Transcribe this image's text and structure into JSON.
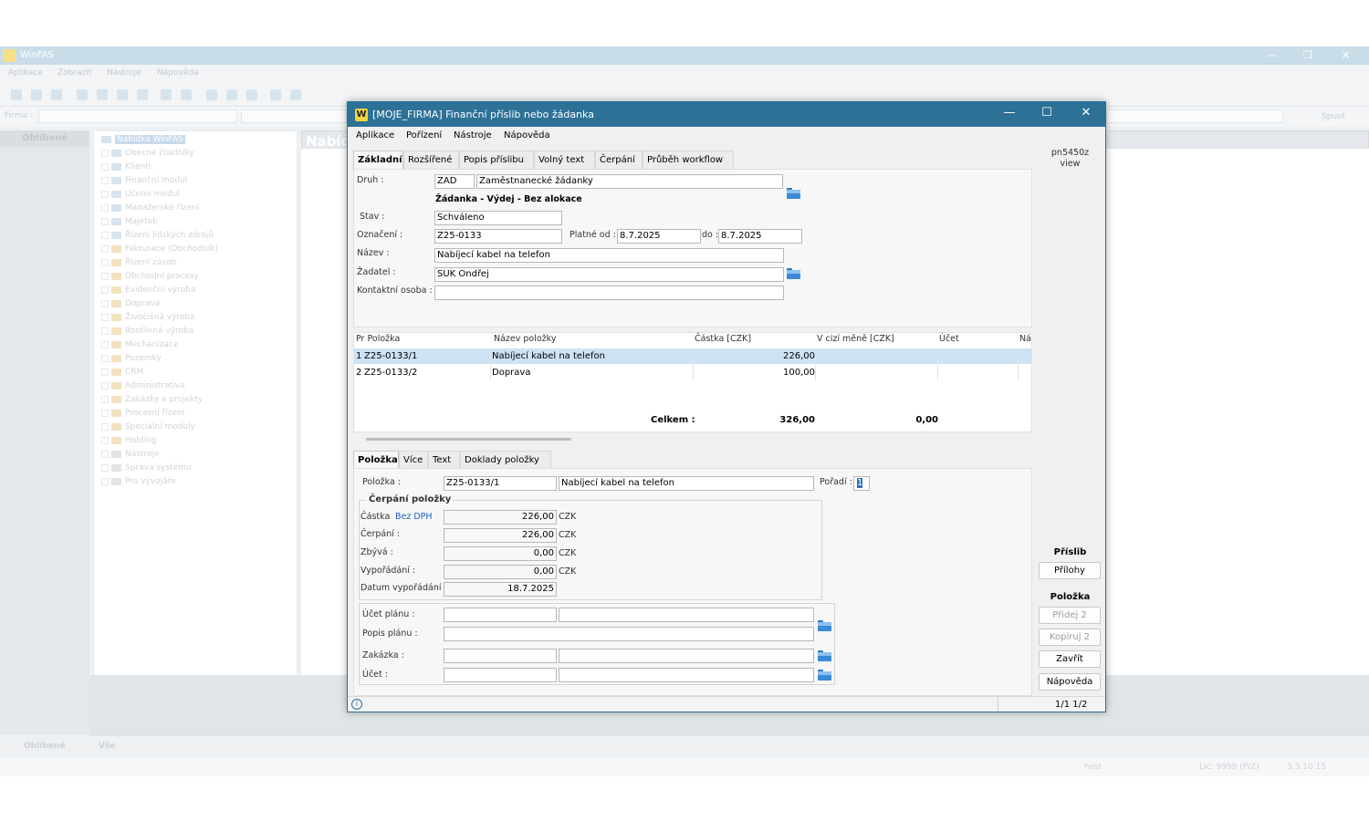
{
  "bg": {
    "title": "WinFAS",
    "menu": [
      "Aplikace",
      "Zobrazit",
      "Nástroje",
      "Nápověda"
    ],
    "firma_label": "Firma :",
    "spust": "Spusť",
    "left_header": "Oblíbené",
    "content_tab": "Nabíd",
    "tree": [
      "Nabídka WinFAS",
      "Obecné číselníky",
      "Klienti",
      "Finanční modul",
      "Účetní modul",
      "Manažerské řízení",
      "Majetek",
      "Řízení lidských zdrojů",
      "Fakturace (Obchodník)",
      "Řízení zásob",
      "Obchodní procesy",
      "Evidenční výroba",
      "Doprava",
      "Živočišná výroba",
      "Rostlinná výroba",
      "Mechanizace",
      "Pozemky",
      "CRM",
      "Administrativa",
      "Zakázky a projekty",
      "Procesní řízení",
      "Speciální moduly",
      "Holding",
      "Nástroje",
      "Správa systému",
      "Pro vývojáře"
    ],
    "status_left": "Oblíbené",
    "status_mid": "Vše",
    "status_host": "host",
    "status_lic": "Lic: 9999 (P/Z)",
    "status_ver": "3.3.10.15"
  },
  "dialog": {
    "title": "[MOJE_FIRMA] Finanční příslib nebo žádanka",
    "logo": "W",
    "menu": [
      "Aplikace",
      "Pořízení",
      "Nástroje",
      "Nápověda"
    ],
    "tabs": [
      "Základní",
      "Rozšířené",
      "Popis příslibu",
      "Volný text",
      "Čerpání",
      "Průběh workflow"
    ],
    "druh_label": "Druh :",
    "druh_code": "ZAD",
    "druh_name": "Zaměstnanecké žádanky",
    "druh_desc": "Žádanka - Výdej - Bez alokace",
    "stav_label": "Stav :",
    "stav": "Schváleno",
    "oznaceni_label": "Označení :",
    "oznaceni": "Z25-0133",
    "platne_od_label": "Platné od :",
    "platne_od": "8.7.2025",
    "do_label": "do :",
    "do": "8.7.2025",
    "nazev_label": "Název :",
    "nazev": "Nabíjecí kabel na telefon",
    "zadatel_label": "Žadatel :",
    "zadatel": "SUK Ondřej",
    "kontakt_label": "Kontaktní osoba :",
    "kontakt": "",
    "grid": {
      "headers": [
        "Pr Položka",
        "Název položky",
        "Částka [CZK]",
        "V cizí měně [CZK]",
        "Účet",
        "Ná"
      ],
      "rows": [
        {
          "pr": "1",
          "polozka": "Z25-0133/1",
          "nazev": "Nabíjecí kabel na telefon",
          "castka": "226,00",
          "cizi": "",
          "ucet": ""
        },
        {
          "pr": "2",
          "polozka": "Z25-0133/2",
          "nazev": "Doprava",
          "castka": "100,00",
          "cizi": "",
          "ucet": ""
        }
      ],
      "total_label": "Celkem :",
      "total_castka": "326,00",
      "total_cizi": "0,00"
    },
    "tabs2": [
      "Položka",
      "Více",
      "Text",
      "Doklady položky"
    ],
    "polozka_label": "Položka :",
    "polozka_code": "Z25-0133/1",
    "polozka_name": "Nabíjecí kabel na telefon",
    "poradi_label": "Pořadí :",
    "poradi": "1",
    "cerpani_group": "Čerpání položky",
    "castka_label": "Částka",
    "bez_dph": "Bez DPH",
    "castka": "226,00",
    "cerpani_label": "Čerpání :",
    "cerpani": "226,00",
    "zbyva_label": "Zbývá :",
    "zbyva": "0,00",
    "vyporadani_label": "Vypořádání :",
    "vyporadani": "0,00",
    "datum_label": "Datum vypořádání :",
    "datum": "18.7.2025",
    "currency": "CZK",
    "ucet_planu_label": "Účet plánu :",
    "popis_planu_label": "Popis plánu :",
    "zakazka_label": "Zakázka :",
    "ucet_label": "Účet :",
    "side": {
      "view_line1": "pn5450z",
      "view_line2": "view",
      "prislib_header": "Příslib",
      "prilohy": "Přílohy",
      "polozka_header": "Položka",
      "pridej": "Přidej 2",
      "kopiruj": "Kopíruj 2",
      "zavrit": "Zavřít",
      "napoveda": "Nápověda"
    },
    "status_info": "i",
    "status_pages": "1/1 1/2"
  }
}
